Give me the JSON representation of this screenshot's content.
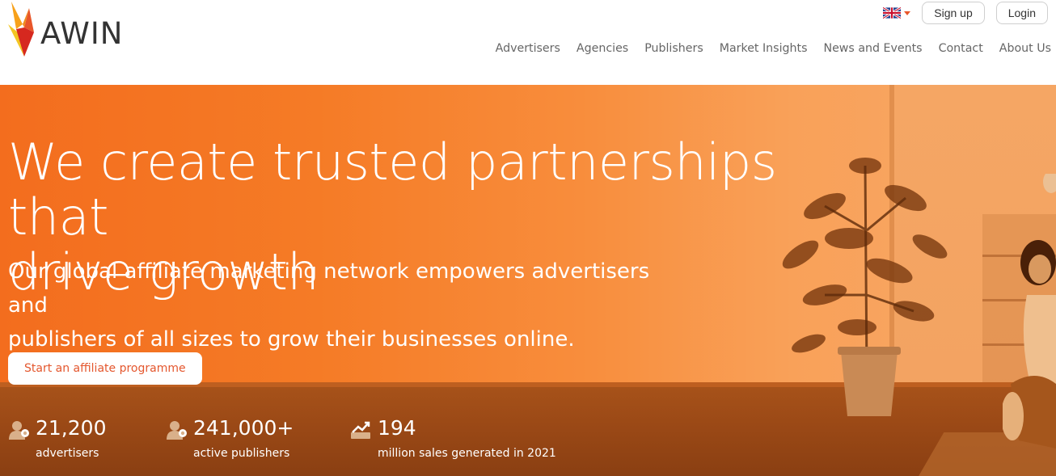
{
  "brand": {
    "name": "AWIN",
    "accent": "#e8562a"
  },
  "header": {
    "language_flag": "uk-flag-icon",
    "signup_label": "Sign up",
    "login_label": "Login"
  },
  "nav": {
    "items": [
      {
        "label": "Advertisers"
      },
      {
        "label": "Agencies"
      },
      {
        "label": "Publishers"
      },
      {
        "label": "Market Insights"
      },
      {
        "label": "News and Events"
      },
      {
        "label": "Contact"
      },
      {
        "label": "About Us"
      }
    ]
  },
  "hero": {
    "headline_line1": "We create trusted partnerships that",
    "headline_line2": "drive growth",
    "subline_line1": "Our global affiliate marketing network empowers advertisers and",
    "subline_line2": "publishers of all sizes to grow their businesses online.",
    "cta_label": "Start an affiliate programme",
    "background_color": "#f57b26"
  },
  "stats": [
    {
      "icon": "advertiser-icon",
      "value": "21,200",
      "label": "advertisers"
    },
    {
      "icon": "publisher-icon",
      "value": "241,000+",
      "label": "active publishers"
    },
    {
      "icon": "growth-chart-icon",
      "value": "194",
      "label": "million sales generated in 2021"
    }
  ]
}
